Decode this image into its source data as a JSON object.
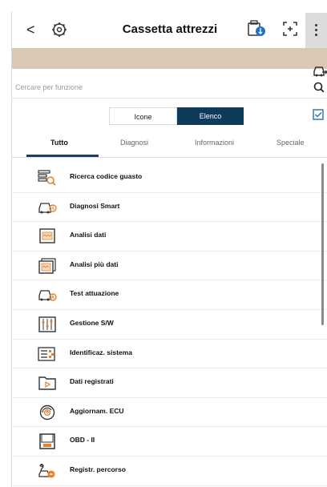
{
  "header": {
    "back_glyph": "<",
    "title": "Cassetta attrezzi",
    "icons": [
      "back-icon",
      "gear-car-icon",
      "usb-link-icon",
      "screen-capture-icon",
      "more-menu-icon"
    ]
  },
  "band": {
    "icon": "car-export-icon"
  },
  "search": {
    "placeholder": "Cercare per funzione",
    "icon": "search-icon"
  },
  "view_toggle": {
    "options": [
      "Icone",
      "Elenco"
    ],
    "selected": "Elenco"
  },
  "tabs": [
    {
      "label": "Tutto",
      "active": true
    },
    {
      "label": "Diagnosi",
      "active": false
    },
    {
      "label": "Informazioni",
      "active": false
    },
    {
      "label": "Speciale",
      "active": false
    }
  ],
  "items": [
    {
      "label": "Ricerca codice guasto",
      "icon": "fault-code-search-icon"
    },
    {
      "label": "Diagnosi Smart",
      "icon": "smart-diagnosis-icon"
    },
    {
      "label": "Analisi dati",
      "icon": "data-analysis-icon"
    },
    {
      "label": "Analisi più dati",
      "icon": "multi-data-analysis-icon"
    },
    {
      "label": "Test attuazione",
      "icon": "actuation-test-icon"
    },
    {
      "label": "Gestione S/W",
      "icon": "software-management-icon"
    },
    {
      "label": "Identificaz. sistema",
      "icon": "system-id-icon"
    },
    {
      "label": "Dati registrati",
      "icon": "recorded-data-icon"
    },
    {
      "label": "Aggiornam. ECU",
      "icon": "ecu-update-icon"
    },
    {
      "label": "OBD - II",
      "icon": "obd-icon"
    },
    {
      "label": "Registr. percorso",
      "icon": "route-record-icon"
    }
  ],
  "colors": {
    "accent": "#0e3a5c",
    "band": "#d8c8b4",
    "icon_orange": "#e8812e"
  }
}
